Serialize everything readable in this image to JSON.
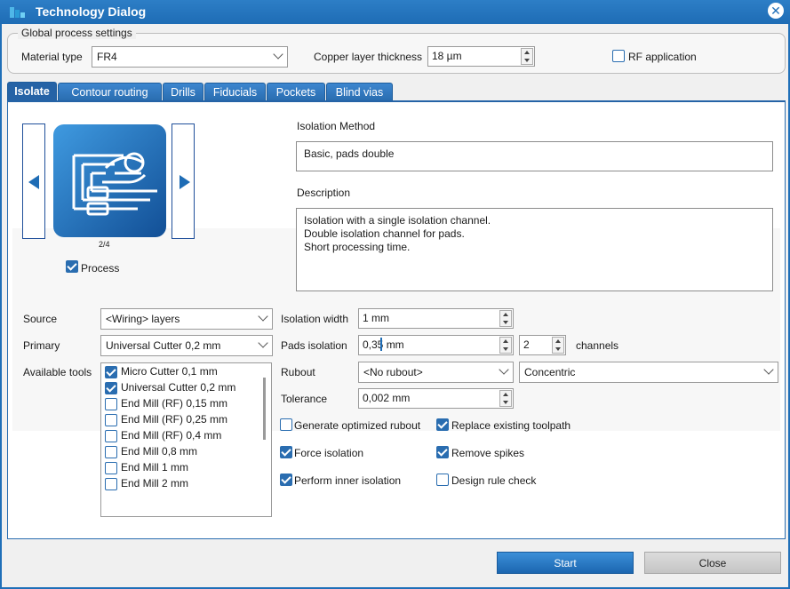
{
  "window": {
    "title": "Technology Dialog"
  },
  "global": {
    "legend": "Global process settings",
    "material_label": "Material type",
    "material_value": "FR4",
    "copper_label": "Copper layer thickness",
    "copper_value": "18 µm",
    "rf_label": "RF application",
    "rf_checked": false
  },
  "tabs": [
    {
      "label": "Isolate",
      "active": true
    },
    {
      "label": "Contour routing",
      "active": false
    },
    {
      "label": "Drills",
      "active": false
    },
    {
      "label": "Fiducials",
      "active": false
    },
    {
      "label": "Pockets",
      "active": false
    },
    {
      "label": "Blind vias",
      "active": false
    }
  ],
  "method": {
    "counter": "2/4",
    "process_label": "Process",
    "process_checked": true,
    "method_label": "Isolation Method",
    "method_value": "Basic, pads double",
    "description_label": "Description",
    "description_lines": [
      "Isolation with a single isolation channel.",
      "Double isolation channel for pads.",
      "Short processing time."
    ]
  },
  "tools": {
    "source_label": "Source",
    "source_value": "<Wiring> layers",
    "primary_label": "Primary",
    "primary_value": "Universal Cutter 0,2 mm",
    "available_label": "Available tools",
    "items": [
      {
        "label": "Micro Cutter 0,1 mm",
        "checked": true
      },
      {
        "label": "Universal Cutter 0,2 mm",
        "checked": true
      },
      {
        "label": "End Mill (RF) 0,15 mm",
        "checked": false
      },
      {
        "label": "End Mill (RF) 0,25 mm",
        "checked": false
      },
      {
        "label": "End Mill (RF) 0,4 mm",
        "checked": false
      },
      {
        "label": "End Mill 0,8 mm",
        "checked": false
      },
      {
        "label": "End Mill 1 mm",
        "checked": false
      },
      {
        "label": "End Mill 2 mm",
        "checked": false
      }
    ]
  },
  "isolation": {
    "width_label": "Isolation width",
    "width_value": "1 mm",
    "pads_label": "Pads isolation",
    "pads_value": "0,35 mm",
    "channels_value": "2",
    "channels_label": "channels",
    "rubout_label": "Rubout",
    "rubout_value": "<No rubout>",
    "rubout_mode": "Concentric",
    "tolerance_label": "Tolerance",
    "tolerance_value": "0,002 mm"
  },
  "options": [
    {
      "label": "Generate optimized rubout",
      "checked": false
    },
    {
      "label": "Replace existing toolpath",
      "checked": true
    },
    {
      "label": "Force isolation",
      "checked": true
    },
    {
      "label": "Remove spikes",
      "checked": true
    },
    {
      "label": "Perform inner isolation",
      "checked": true
    },
    {
      "label": "Design rule check",
      "checked": false
    }
  ],
  "buttons": {
    "start": "Start",
    "close": "Close"
  },
  "colors": {
    "accent": "#1f6fb8",
    "tab": "#2a6db0",
    "checkbox": "#2a6db0"
  }
}
